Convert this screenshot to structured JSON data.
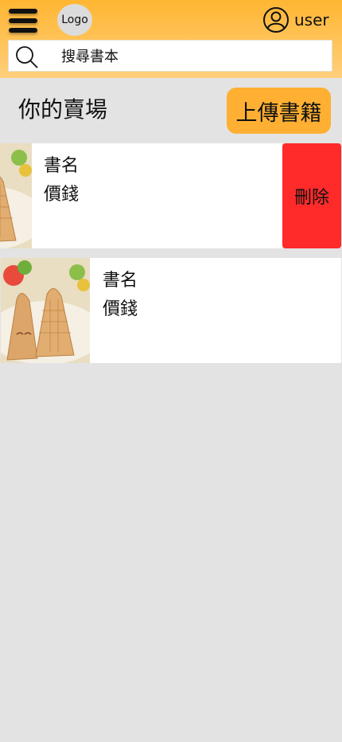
{
  "header": {
    "menu_icon": "hamburger-menu-icon",
    "logo_label": "Logo",
    "user_icon": "user-circle-icon",
    "user_label": "user",
    "accent_color": "#ffb632"
  },
  "search": {
    "icon": "search-icon",
    "placeholder": "搜尋書本",
    "value": ""
  },
  "page": {
    "title": "你的賣場",
    "upload_label": "上傳書籍"
  },
  "books": [
    {
      "title": "書名",
      "price": "價錢",
      "image": "waffle-dessert-plate",
      "delete_label": "刪除",
      "delete_color": "#ff2a2a"
    },
    {
      "title": "書名",
      "price": "價錢",
      "image": "waffle-dessert-plate"
    }
  ]
}
